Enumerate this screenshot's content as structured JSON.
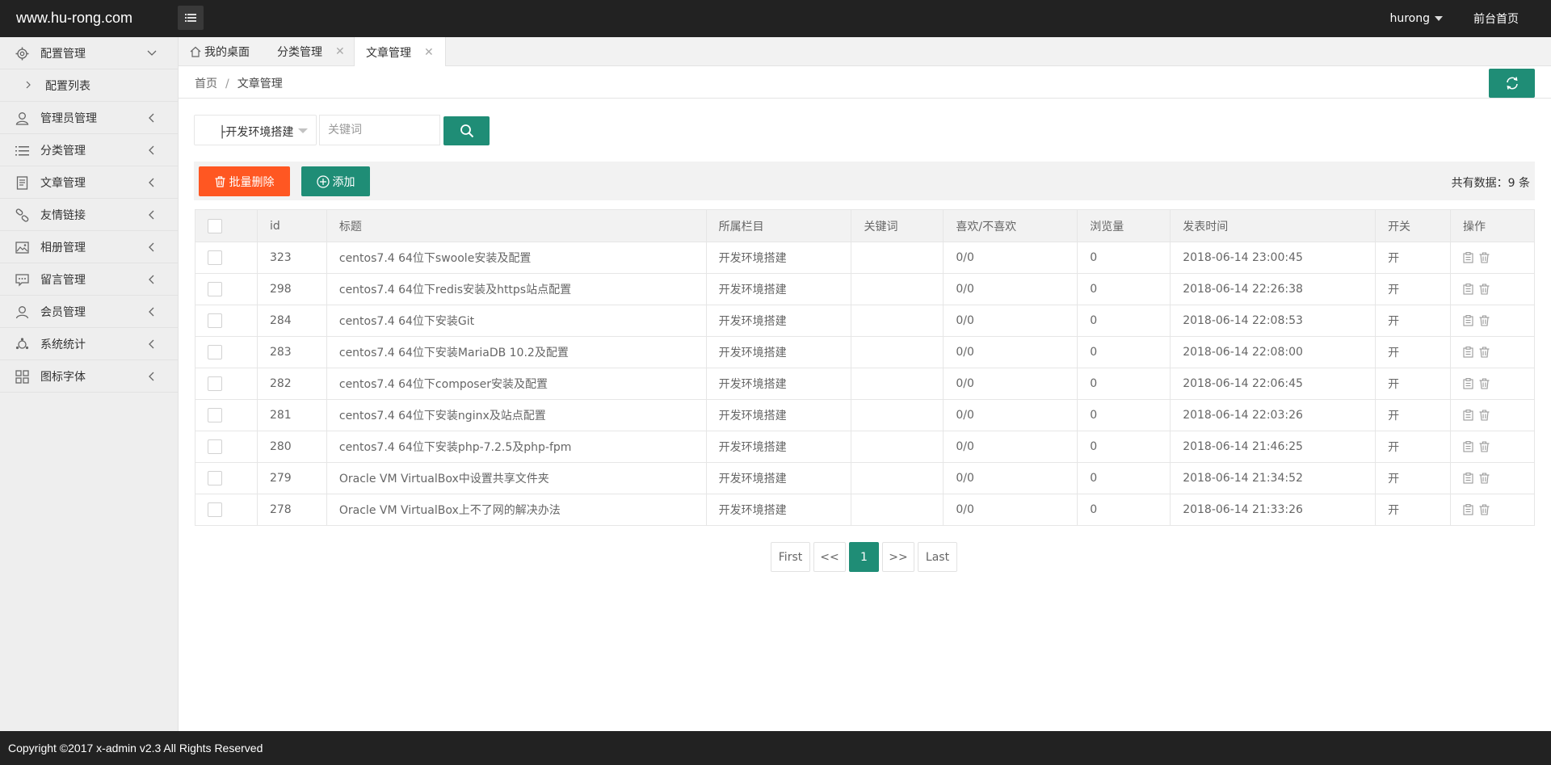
{
  "header": {
    "logo": "www.hu-rong.com",
    "username": "hurong",
    "front_link": "前台首页"
  },
  "sidebar": {
    "items": [
      {
        "label": "配置管理",
        "icon": "gear-icon",
        "expanded": true
      },
      {
        "label": "配置列表",
        "sub": true
      },
      {
        "label": "管理员管理",
        "icon": "user-icon"
      },
      {
        "label": "分类管理",
        "icon": "list-icon"
      },
      {
        "label": "文章管理",
        "icon": "document-icon"
      },
      {
        "label": "友情链接",
        "icon": "link-icon"
      },
      {
        "label": "相册管理",
        "icon": "image-icon"
      },
      {
        "label": "留言管理",
        "icon": "message-icon"
      },
      {
        "label": "会员管理",
        "icon": "member-icon"
      },
      {
        "label": "系统统计",
        "icon": "stats-icon"
      },
      {
        "label": "图标字体",
        "icon": "grid-icon"
      }
    ]
  },
  "tabs": [
    {
      "label": "我的桌面",
      "closable": false
    },
    {
      "label": "分类管理",
      "closable": true
    },
    {
      "label": "文章管理",
      "closable": true,
      "active": true
    }
  ],
  "breadcrumb": {
    "home": "首页",
    "sep": "/",
    "current": "文章管理"
  },
  "filter": {
    "category_value": "├开发环境搭建",
    "keyword_placeholder": "关键词"
  },
  "toolbar": {
    "bulk_delete": "批量删除",
    "add": "添加",
    "total": "共有数据：9 条"
  },
  "table": {
    "headers": [
      "id",
      "标题",
      "所属栏目",
      "关键词",
      "喜欢/不喜欢",
      "浏览量",
      "发表时间",
      "开关",
      "操作"
    ],
    "rows": [
      {
        "id": "323",
        "title": "centos7.4 64位下swoole安装及配置",
        "category": "开发环境搭建",
        "keywords": "",
        "likes": "0/0",
        "views": "0",
        "time": "2018-06-14 23:00:45",
        "status": "开"
      },
      {
        "id": "298",
        "title": "centos7.4 64位下redis安装及https站点配置",
        "category": "开发环境搭建",
        "keywords": "",
        "likes": "0/0",
        "views": "0",
        "time": "2018-06-14 22:26:38",
        "status": "开"
      },
      {
        "id": "284",
        "title": "centos7.4 64位下安装Git",
        "category": "开发环境搭建",
        "keywords": "",
        "likes": "0/0",
        "views": "0",
        "time": "2018-06-14 22:08:53",
        "status": "开"
      },
      {
        "id": "283",
        "title": "centos7.4 64位下安装MariaDB 10.2及配置",
        "category": "开发环境搭建",
        "keywords": "",
        "likes": "0/0",
        "views": "0",
        "time": "2018-06-14 22:08:00",
        "status": "开"
      },
      {
        "id": "282",
        "title": "centos7.4 64位下composer安装及配置",
        "category": "开发环境搭建",
        "keywords": "",
        "likes": "0/0",
        "views": "0",
        "time": "2018-06-14 22:06:45",
        "status": "开"
      },
      {
        "id": "281",
        "title": "centos7.4 64位下安装nginx及站点配置",
        "category": "开发环境搭建",
        "keywords": "",
        "likes": "0/0",
        "views": "0",
        "time": "2018-06-14 22:03:26",
        "status": "开"
      },
      {
        "id": "280",
        "title": "centos7.4 64位下安装php-7.2.5及php-fpm",
        "category": "开发环境搭建",
        "keywords": "",
        "likes": "0/0",
        "views": "0",
        "time": "2018-06-14 21:46:25",
        "status": "开"
      },
      {
        "id": "279",
        "title": "Oracle VM VirtualBox中设置共享文件夹",
        "category": "开发环境搭建",
        "keywords": "",
        "likes": "0/0",
        "views": "0",
        "time": "2018-06-14 21:34:52",
        "status": "开"
      },
      {
        "id": "278",
        "title": "Oracle VM VirtualBox上不了网的解决办法",
        "category": "开发环境搭建",
        "keywords": "",
        "likes": "0/0",
        "views": "0",
        "time": "2018-06-14 21:33:26",
        "status": "开"
      }
    ]
  },
  "pagination": {
    "first": "First",
    "prev": "<<",
    "current": "1",
    "next": ">>",
    "last": "Last"
  },
  "footer": {
    "text": "Copyright ©2017 x-admin v2.3 All Rights Reserved"
  },
  "colors": {
    "accent": "#1f8d76",
    "danger": "#ff5722",
    "header": "#222222"
  }
}
